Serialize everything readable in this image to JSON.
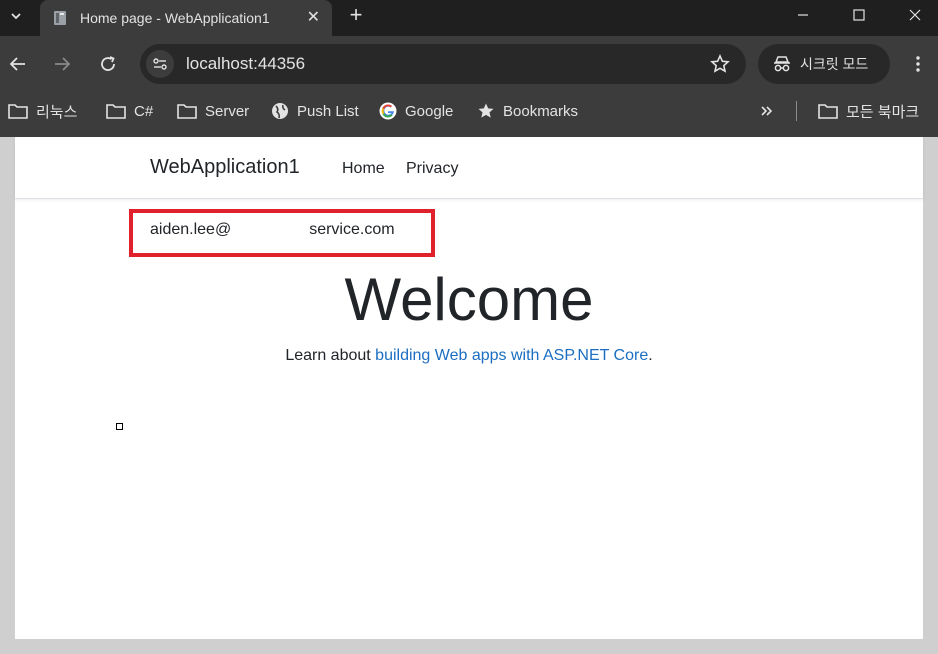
{
  "browser": {
    "tab_title": "Home page - WebApplication1",
    "url": "localhost:44356",
    "incognito_label": "시크릿 모드",
    "bookmarks": [
      {
        "label": "리눅스",
        "icon": "folder-icon"
      },
      {
        "label": "C#",
        "icon": "folder-icon"
      },
      {
        "label": "Server",
        "icon": "folder-icon"
      },
      {
        "label": "Push List",
        "icon": "globe-icon"
      },
      {
        "label": "Google",
        "icon": "google-icon"
      },
      {
        "label": "Bookmarks",
        "icon": "star-icon"
      }
    ],
    "all_bookmarks_label": "모든 북마크"
  },
  "site": {
    "brand": "WebApplication1",
    "nav": {
      "home": "Home",
      "privacy": "Privacy"
    },
    "user_email_prefix": "aiden.lee@",
    "user_email_suffix": "service.com",
    "heading": "Welcome",
    "learn_prefix": "Learn about ",
    "learn_link": "building Web apps with ASP.NET Core",
    "learn_suffix": "."
  },
  "colors": {
    "highlight": "#e0202a",
    "link": "#1b6ec2",
    "chrome_dark": "#1f1f1f",
    "toolbar": "#3c3c3c"
  }
}
